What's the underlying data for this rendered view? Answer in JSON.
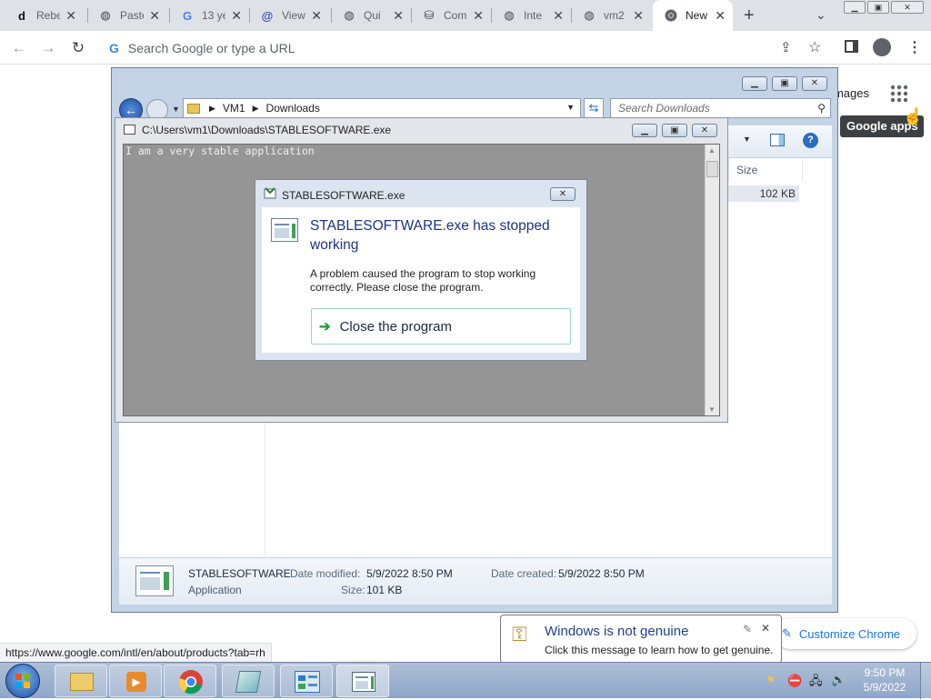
{
  "tabs": [
    {
      "title": "Rebe",
      "icon": "d"
    },
    {
      "title": "Paste",
      "icon": "globe"
    },
    {
      "title": "13 ye",
      "icon": "G"
    },
    {
      "title": "View",
      "icon": "@"
    },
    {
      "title": "Qui",
      "icon": "globe"
    },
    {
      "title": "Com",
      "icon": "stack"
    },
    {
      "title": "Inte",
      "icon": "globe"
    },
    {
      "title": "vm2",
      "icon": "globe"
    },
    {
      "title": "New",
      "icon": "chrome",
      "active": true
    }
  ],
  "omnibox": {
    "placeholder": "Search Google or type a URL"
  },
  "ntp": {
    "images_link": "Images",
    "apps_tooltip": "Google apps",
    "customize": "Customize Chrome"
  },
  "status_url": "https://www.google.com/intl/en/about/products?tab=rh",
  "explorer": {
    "breadcrumb": [
      "VM1",
      "Downloads"
    ],
    "search_placeholder": "Search Downloads",
    "column_size": "Size",
    "row_size": "102 KB",
    "details": {
      "name": "STABLESOFTWARE",
      "type": "Application",
      "date_modified_label": "Date modified:",
      "date_modified": "5/9/2022 8:50 PM",
      "date_created_label": "Date created:",
      "date_created": "5/9/2022 8:50 PM",
      "size_label": "Size:",
      "size": "101 KB"
    }
  },
  "console": {
    "title": "C:\\Users\\vm1\\Downloads\\STABLESOFTWARE.exe",
    "output": "I am a very stable application"
  },
  "dialog": {
    "title": "STABLESOFTWARE.exe",
    "heading": "STABLESOFTWARE.exe has stopped working",
    "message": "A problem caused the program to stop working correctly. Please close the program.",
    "action": "Close the program"
  },
  "balloon": {
    "title": "Windows is not genuine",
    "message": "Click this message to learn how to get genuine."
  },
  "clock": {
    "time": "9:50 PM",
    "date": "5/9/2022"
  },
  "colors": {
    "accent": "#1a73e8",
    "dialog_heading": "#1e3287",
    "console_bg": "#959595"
  }
}
